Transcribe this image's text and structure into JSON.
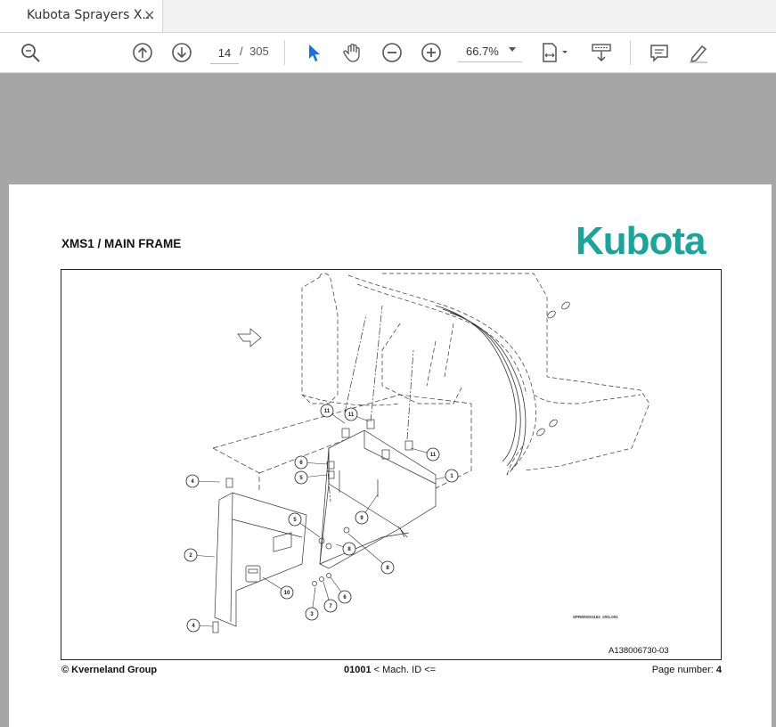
{
  "app": {
    "tab_title": "Kubota Sprayers X...",
    "tab_close": "×"
  },
  "toolbar": {
    "page_current": "14",
    "page_separator": "/",
    "page_total": "305",
    "zoom": "66.7%",
    "icons": [
      "zoom-search-icon",
      "page-up-icon",
      "page-down-icon",
      "select-cursor-icon",
      "hand-pan-icon",
      "zoom-out-icon",
      "zoom-in-icon",
      "fit-page-icon",
      "scroll-mode-icon",
      "comment-icon",
      "pen-sign-icon"
    ]
  },
  "document": {
    "title": "XMS1 / MAIN FRAME",
    "brand": "Kubota",
    "brand_color": "#1aa59b",
    "drawing_code": "A138006730-03",
    "small_ref": "SPRMS001162_0/01.001",
    "footer_left": "© Kverneland Group",
    "footer_mid_code": "01001",
    "footer_mid_text": " < Mach. ID <=",
    "footer_right_label": "Page number: ",
    "footer_right_value": "4",
    "callouts": [
      "11",
      "11",
      "11",
      "6",
      "5",
      "1",
      "4",
      "9",
      "5",
      "2",
      "8",
      "8",
      "10",
      "3",
      "7",
      "6",
      "4"
    ]
  }
}
